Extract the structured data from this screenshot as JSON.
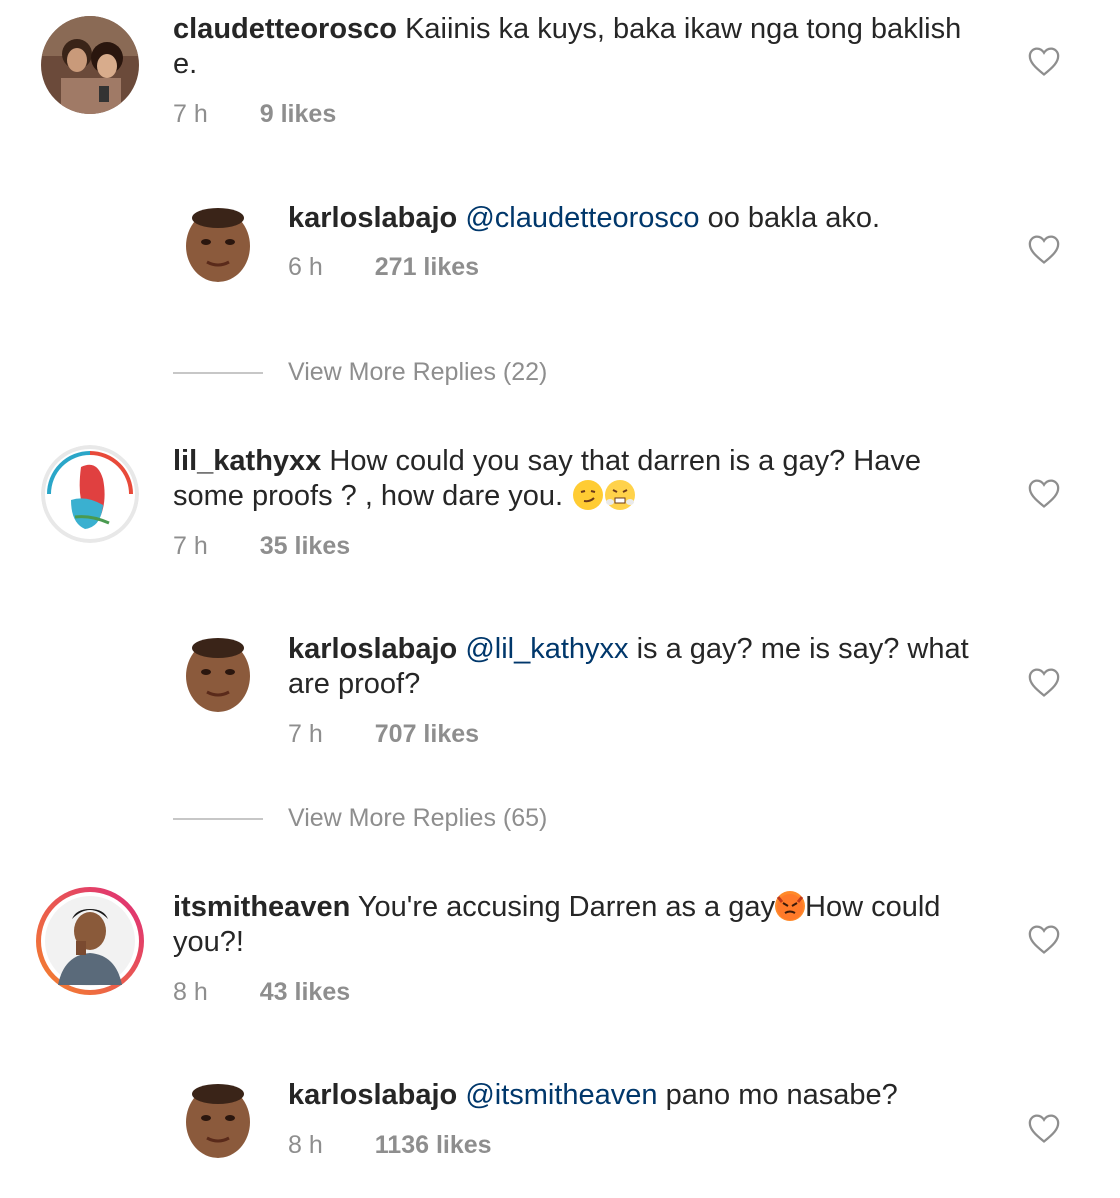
{
  "comments": [
    {
      "username": "claudetteorosco",
      "text": "Kaiinis ka kuys, baka ikaw nga tong baklish e.",
      "time": "7 h",
      "likes": "9 likes"
    },
    {
      "username": "karloslabajo",
      "mention": "@claudetteorosco",
      "text": "oo bakla ako.",
      "time": "6 h",
      "likes": "271 likes"
    },
    {
      "username": "lil_kathyxx",
      "text_line1": "How could you say that darren is a gay? Have",
      "text_line2": "some proofs ? , how dare you.",
      "emojis": [
        "smirking-face-emoji",
        "angry-steam-face-emoji"
      ],
      "time": "7 h",
      "likes": "35 likes"
    },
    {
      "username": "karloslabajo",
      "mention": "@lil_kathyxx",
      "text": "is a gay? me is say? what are proof?",
      "time": "7 h",
      "likes": "707 likes"
    },
    {
      "username": "itsmitheaven",
      "text_before": "You're accusing Darren as a gay",
      "emoji": "angry-devil-face-emoji",
      "text_after": "How could you?!",
      "time": "8 h",
      "likes": "43 likes"
    },
    {
      "username": "karloslabajo",
      "mention": "@itsmitheaven",
      "text": "pano mo nasabe?",
      "time": "8 h",
      "likes": "1136 likes"
    }
  ],
  "view_more": [
    "View More Replies (22)",
    "View More Replies (65)"
  ],
  "colors": {
    "text": "#262626",
    "secondary": "#8e8e8e",
    "mention": "#00376b",
    "story_ring_start": "#f58529",
    "story_ring_end": "#dd2a7b"
  },
  "icons": {
    "like": "heart-outline-icon"
  }
}
